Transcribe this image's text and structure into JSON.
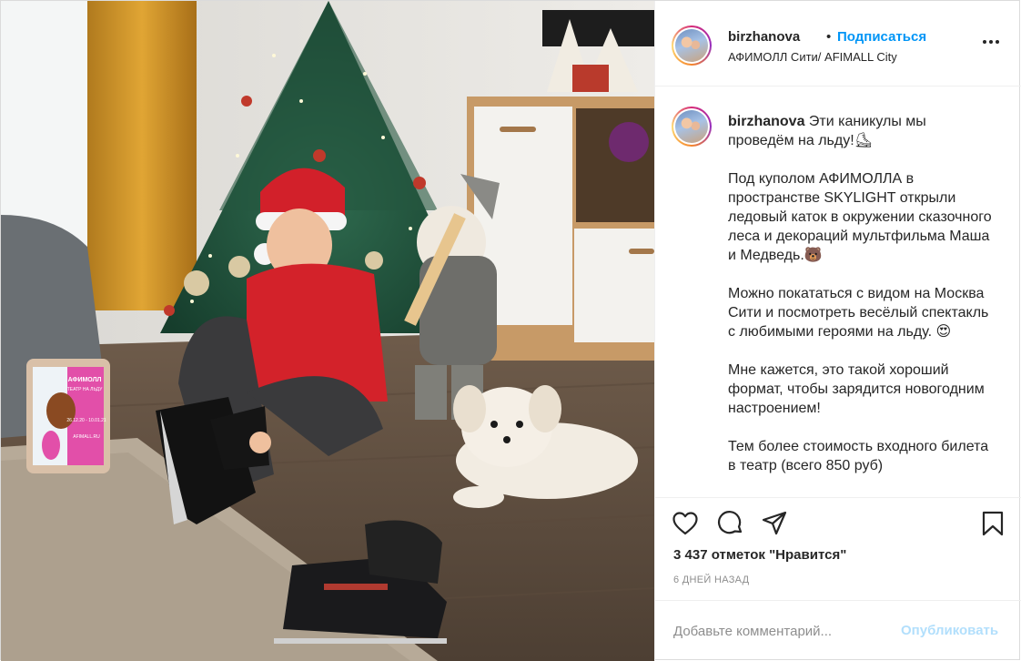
{
  "post": {
    "username": "birzhanova",
    "header_dot": "•",
    "follow_label": "Подписаться",
    "location": "АФИМОЛЛ Сити/ AFIMALL City",
    "caption": {
      "username": "birzhanova",
      "text": " Эти каникулы мы проведём на льду!⛸\n\nПод куполом АФИМОЛЛА в пространстве SKYLIGHT открыли ледовый каток в окружении сказочного леса и декораций мультфильма Маша и Медведь.🐻\n\nМожно покататься с видом на Москва Сити и посмотреть весёлый спектакль с любимыми героями на льду. 😍\n\nМне кажется, это такой хороший формат, чтобы зарядится новогодним настроением!\n\nТем более стоимость входного билета в театр (всего 850 руб)"
    },
    "likes": "3 437 отметок \"Нравится\"",
    "date": "6 ДНЕЙ НАЗАД",
    "comment": {
      "placeholder": "Добавьте комментарий...",
      "publish_label": "Опубликовать"
    },
    "tablet_screen": {
      "brand": "АФИМОЛЛ",
      "line2": "ТЕАТР НА ЛЬДУ",
      "dates": "26.12.20 - 10.01.21",
      "site": "AFIMALL.RU"
    }
  },
  "colors": {
    "accent": "#0095f6",
    "publish_disabled": "#b2dffc",
    "muted": "#8e8e8e",
    "text": "#262626"
  },
  "icons": [
    "heart-icon",
    "comment-icon",
    "share-icon",
    "bookmark-icon",
    "more-icon"
  ]
}
